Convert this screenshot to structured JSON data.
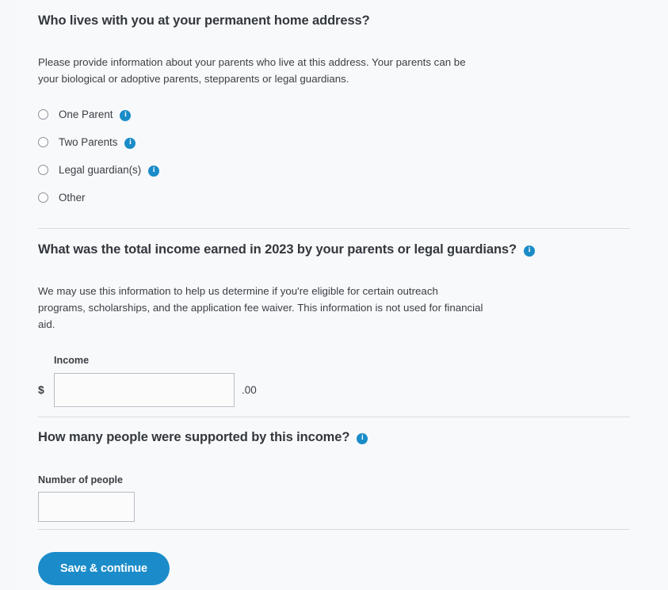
{
  "theme": {
    "accent": "#1a8cc8",
    "button_bg": "#1b8cc9",
    "page_bg": "#f8f9fb",
    "text": "#3b4045",
    "divider": "#d9dcdf",
    "input_border": "#b9bdc2"
  },
  "icons": {
    "info": "i"
  },
  "household": {
    "heading": "Who lives with you at your permanent home address?",
    "body_line1": "Please provide information about your parents who live at this address. Your parents can be",
    "body_line2": "your biological or adoptive parents, stepparents or legal guardians.",
    "options": [
      {
        "label": "One Parent",
        "has_info": true
      },
      {
        "label": "Two Parents",
        "has_info": true
      },
      {
        "label": "Legal guardian(s)",
        "has_info": true
      },
      {
        "label": "Other",
        "has_info": false
      }
    ]
  },
  "income": {
    "heading": "What was the total income earned in 2023 by your parents or legal guardians?",
    "body_line1": "We may use this information to help us determine if you're eligible for certain outreach",
    "body_line2": "programs, scholarships, and the application fee waiver. This information is not used for financial",
    "body_line3": "aid.",
    "field_label": "Income",
    "currency_prefix": "$",
    "decimal_suffix": ".00",
    "value": "",
    "placeholder": ""
  },
  "supported": {
    "heading": "How many people were supported by this income?",
    "field_label": "Number of people",
    "value": "",
    "placeholder": ""
  },
  "footer": {
    "save_label": "Save & continue"
  }
}
